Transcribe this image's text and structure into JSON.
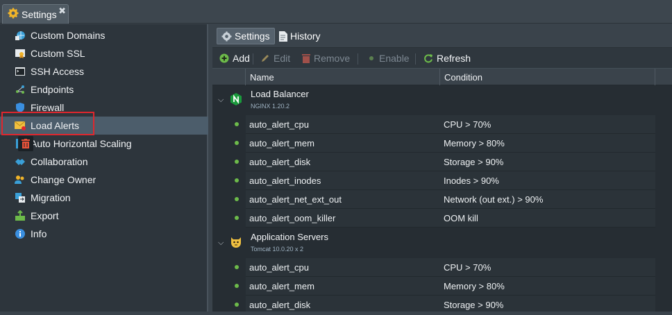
{
  "window": {
    "tab_label": "Settings",
    "close_glyph": "✖"
  },
  "sidebar": {
    "items": [
      {
        "label": "Custom Domains",
        "icon": "globe-icon"
      },
      {
        "label": "Custom SSL",
        "icon": "certificate-icon"
      },
      {
        "label": "SSH Access",
        "icon": "terminal-icon"
      },
      {
        "label": "Endpoints",
        "icon": "endpoints-icon"
      },
      {
        "label": "Firewall",
        "icon": "shield-icon"
      },
      {
        "label": "Load Alerts",
        "icon": "alert-envelope-icon"
      },
      {
        "label": "Auto Horizontal Scaling",
        "icon": "scaling-icon"
      },
      {
        "label": "Collaboration",
        "icon": "handshake-icon"
      },
      {
        "label": "Change Owner",
        "icon": "users-icon"
      },
      {
        "label": "Migration",
        "icon": "migration-icon"
      },
      {
        "label": "Export",
        "icon": "export-icon"
      },
      {
        "label": "Info",
        "icon": "info-icon"
      }
    ],
    "active_index": 5
  },
  "panel": {
    "tabs": [
      {
        "label": "Settings",
        "icon": "gear-icon"
      },
      {
        "label": "History",
        "icon": "document-icon"
      }
    ],
    "toolbar": {
      "add": "Add",
      "edit": "Edit",
      "remove": "Remove",
      "enable": "Enable",
      "refresh": "Refresh"
    },
    "columns": {
      "name": "Name",
      "condition": "Condition"
    },
    "groups": [
      {
        "name": "Load Balancer",
        "subtitle": "NGINX 1.20.2",
        "icon": "nginx-icon",
        "rows": [
          {
            "name": "auto_alert_cpu",
            "condition": "CPU > 70%"
          },
          {
            "name": "auto_alert_mem",
            "condition": "Memory > 80%"
          },
          {
            "name": "auto_alert_disk",
            "condition": "Storage > 90%"
          },
          {
            "name": "auto_alert_inodes",
            "condition": "Inodes > 90%"
          },
          {
            "name": "auto_alert_net_ext_out",
            "condition": "Network (out ext.) > 90%"
          },
          {
            "name": "auto_alert_oom_killer",
            "condition": "OOM kill"
          }
        ]
      },
      {
        "name": "Application Servers",
        "subtitle": "Tomcat 10.0.20 x 2",
        "icon": "tomcat-icon",
        "rows": [
          {
            "name": "auto_alert_cpu",
            "condition": "CPU > 70%"
          },
          {
            "name": "auto_alert_mem",
            "condition": "Memory > 80%"
          },
          {
            "name": "auto_alert_disk",
            "condition": "Storage > 90%"
          }
        ]
      }
    ]
  },
  "colors": {
    "accent_highlight": "#e1262d",
    "status_dot": "#6dbb4a",
    "active_item": "#4c5d6b"
  }
}
